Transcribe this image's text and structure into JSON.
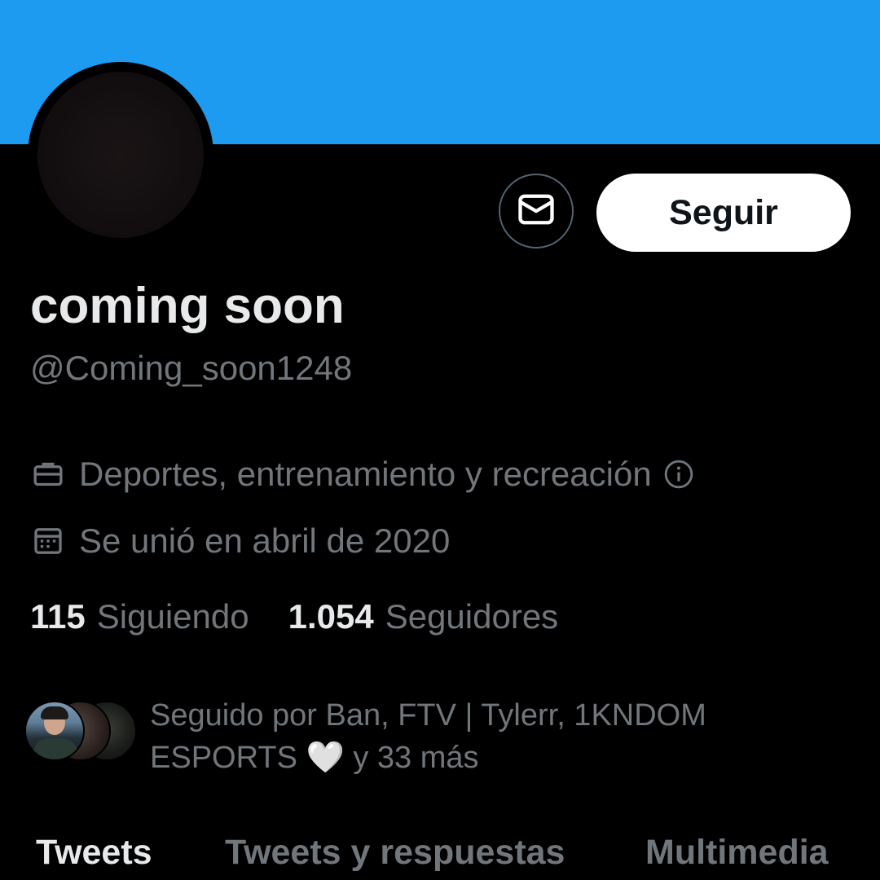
{
  "profile": {
    "display_name": "coming soon",
    "handle": "@Coming_soon1248",
    "category": "Deportes, entrenamiento y recreación",
    "joined": "Se unió en abril de 2020"
  },
  "actions": {
    "follow_label": "Seguir",
    "message_icon": "mail-icon"
  },
  "stats": {
    "following_count": "115",
    "following_label": "Siguiendo",
    "followers_count": "1.054",
    "followers_label": "Seguidores"
  },
  "followed_by": {
    "text_before_heart": "Seguido por Ban, FTV | Tylerr, 1KNDOM ESPORTS ",
    "heart": "🤍",
    "text_after_heart": " y 33 más"
  },
  "tabs": [
    {
      "label": "Tweets",
      "active": true
    },
    {
      "label": "Tweets y respuestas",
      "active": false
    },
    {
      "label": "Multimedia",
      "active": false
    }
  ],
  "colors": {
    "banner": "#1d9bf0",
    "background": "#000000",
    "primary_text": "#e7e9ea",
    "secondary_text": "#71767b"
  }
}
